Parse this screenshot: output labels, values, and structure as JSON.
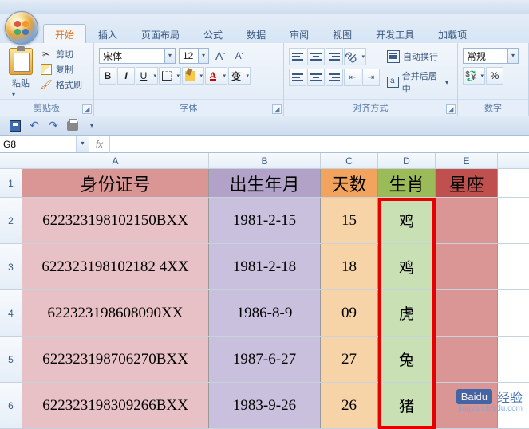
{
  "tabs": {
    "t0": "开始",
    "t1": "插入",
    "t2": "页面布局",
    "t3": "公式",
    "t4": "数据",
    "t5": "审阅",
    "t6": "视图",
    "t7": "开发工具",
    "t8": "加载项"
  },
  "groups": {
    "clipboard": "剪贴板",
    "font": "字体",
    "align": "对齐方式",
    "number": "数字"
  },
  "clipboard": {
    "paste": "粘贴",
    "cut": "剪切",
    "copy": "复制",
    "format": "格式刷"
  },
  "font": {
    "name": "宋体",
    "size": "12",
    "bold": "B",
    "italic": "I",
    "underline": "U",
    "bigA": "A",
    "smallA": "A",
    "colorA": "A",
    "wen": "变"
  },
  "align": {
    "wrap": "自动换行",
    "merge": "合并后居中"
  },
  "number": {
    "format": "常规"
  },
  "namebox": "G8",
  "fx": "fx",
  "cols": {
    "A": "A",
    "B": "B",
    "C": "C",
    "D": "D",
    "E": "E"
  },
  "rownums": {
    "r1": "1",
    "r2": "2",
    "r3": "3",
    "r4": "4",
    "r5": "5",
    "r6": "6"
  },
  "headers": {
    "A": "身份证号",
    "B": "出生年月",
    "C": "天数",
    "D": "生肖",
    "E": "星座"
  },
  "rows": [
    {
      "A": "622323198102150BXX",
      "B": "1981-2-15",
      "C": "15",
      "D": "鸡",
      "E": ""
    },
    {
      "A": "622323198102182 4XX",
      "B": "1981-2-18",
      "C": "18",
      "D": "鸡",
      "E": ""
    },
    {
      "A": "622323198608090XX",
      "B": "1986-8-9",
      "C": "09",
      "D": "虎",
      "E": ""
    },
    {
      "A": "622323198706270BXX",
      "B": "1987-6-27",
      "C": "27",
      "D": "兔",
      "E": ""
    },
    {
      "A": "622323198309266BXX",
      "B": "1983-9-26",
      "C": "26",
      "D": "猪",
      "E": ""
    }
  ],
  "watermark": {
    "brand": "Baidu",
    "label": "经验",
    "url": "jingyan.baidu.com"
  }
}
